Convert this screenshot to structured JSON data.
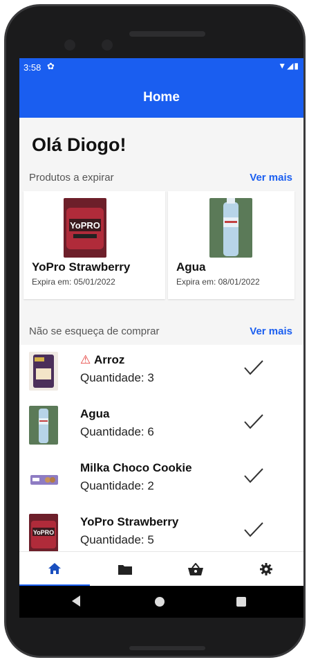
{
  "status_bar": {
    "time": "3:58",
    "right_icons": "▼◢▮"
  },
  "header": {
    "title": "Home"
  },
  "greeting": "Olá Diogo!",
  "expiring": {
    "section_title": "Produtos a expirar",
    "more_label": "Ver mais",
    "items": [
      {
        "name": "YoPro Strawberry",
        "expiry": "Expira em: 05/01/2022"
      },
      {
        "name": "Agua",
        "expiry": "Expira em: 08/01/2022"
      }
    ]
  },
  "shopping": {
    "section_title": "Não se esqueça de comprar",
    "more_label": "Ver mais",
    "items": [
      {
        "warning": "⚠ ",
        "name": "Arroz",
        "quantity": "Quantidade: 3"
      },
      {
        "warning": "",
        "name": "Agua",
        "quantity": "Quantidade: 6"
      },
      {
        "warning": "",
        "name": "Milka Choco Cookie",
        "quantity": "Quantidade: 2"
      },
      {
        "warning": "",
        "name": "YoPro Strawberry",
        "quantity": "Quantidade: 5"
      }
    ]
  },
  "bottom_nav": {
    "items": [
      {
        "icon": "home-icon",
        "active": true
      },
      {
        "icon": "folder-icon",
        "active": false
      },
      {
        "icon": "basket-icon",
        "active": false
      },
      {
        "icon": "gear-icon",
        "active": false
      }
    ]
  },
  "colors": {
    "primary": "#1a5ef0",
    "warning": "#e53935"
  }
}
